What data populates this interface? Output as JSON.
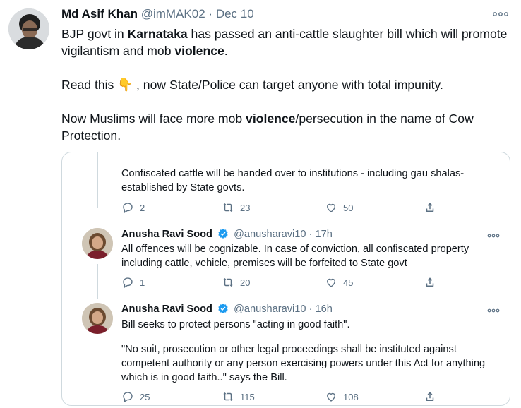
{
  "tweet": {
    "author_name": "Md Asif Khan",
    "handle": "@imMAK02",
    "separator": "·",
    "date": "Dec 10",
    "para1_a": "BJP govt in ",
    "para1_b": "Karnataka",
    "para1_c": " has passed an anti-cattle slaughter bill which will promote vigilantism and mob ",
    "para1_d": "violence",
    "para1_e": ".",
    "para2_a": "Read this ",
    "para2_emoji": "👇",
    "para2_b": " , now State/Police can target anyone with total impunity.",
    "para3_a": "Now Muslims will face more mob ",
    "para3_b": "violence",
    "para3_c": "/persecution in the name of Cow Protection."
  },
  "quoted": {
    "first": {
      "text": "Confiscated cattle will be handed over to institutions - including gau shalas- established by State govts.",
      "replies": "2",
      "retweets": "23",
      "likes": "50"
    },
    "second": {
      "name": "Anusha Ravi Sood",
      "handle": "@anusharavi10",
      "separator": "·",
      "time": "17h",
      "text": "All offences will be cognizable. In case of conviction, all confiscated property including cattle, vehicle, premises will be forfeited to State govt",
      "replies": "1",
      "retweets": "20",
      "likes": "45"
    },
    "third": {
      "name": "Anusha Ravi Sood",
      "handle": "@anusharavi10",
      "separator": "·",
      "time": "16h",
      "text1": "Bill seeks to protect persons \"acting in good faith\".",
      "text2": "\"No suit, prosecution or other legal proceedings shall be instituted against competent authority or any person exercising powers under this Act for anything which is in good faith..\" says the Bill.",
      "replies": "25",
      "retweets": "115",
      "likes": "108"
    }
  },
  "colors": {
    "verified": "#1d9bf0",
    "muted": "#5b7083",
    "border": "#cfd9de"
  },
  "icons": [
    "more-icon",
    "reply-icon",
    "retweet-icon",
    "like-icon",
    "share-icon",
    "verified-badge-icon",
    "pointing-down-emoji"
  ]
}
